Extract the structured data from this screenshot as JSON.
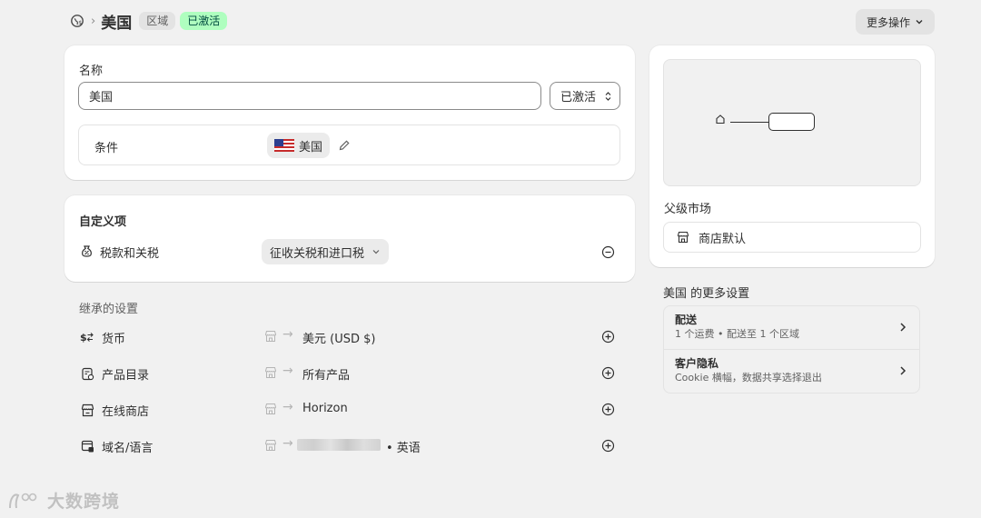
{
  "header": {
    "title": "美国",
    "badge_region": "区域",
    "badge_status": "已激活",
    "more_actions": "更多操作"
  },
  "name_card": {
    "name_label": "名称",
    "name_value": "美国",
    "status_select": "已激活",
    "condition_label": "条件",
    "condition_chip": "美国"
  },
  "custom_card": {
    "title": "自定义项",
    "tax_label": "税款和关税",
    "tax_select": "征收关税和进口税"
  },
  "inherited": {
    "title": "继承的设置",
    "rows": [
      {
        "label": "货币",
        "value": "美元 (USD $)"
      },
      {
        "label": "产品目录",
        "value": "所有产品"
      },
      {
        "label": "在线商店",
        "value": "Horizon"
      },
      {
        "label": "域名/语言",
        "value": "• 英语"
      }
    ]
  },
  "right_card": {
    "parent_market_label": "父级市场",
    "parent_market_value": "商店默认"
  },
  "more_settings": {
    "title": "美国 的更多设置",
    "items": [
      {
        "title": "配送",
        "subtitle": "1 个运费 • 配送至 1 个区域"
      },
      {
        "title": "客户隐私",
        "subtitle": "Cookie 横幅，数据共享选择退出"
      }
    ]
  },
  "watermark": "大数跨境",
  "colors": {
    "page_bg": "#f1f1f1",
    "card_bg": "#ffffff",
    "badge_green_bg": "#affebf",
    "badge_grey_bg": "#e3e3e3"
  }
}
